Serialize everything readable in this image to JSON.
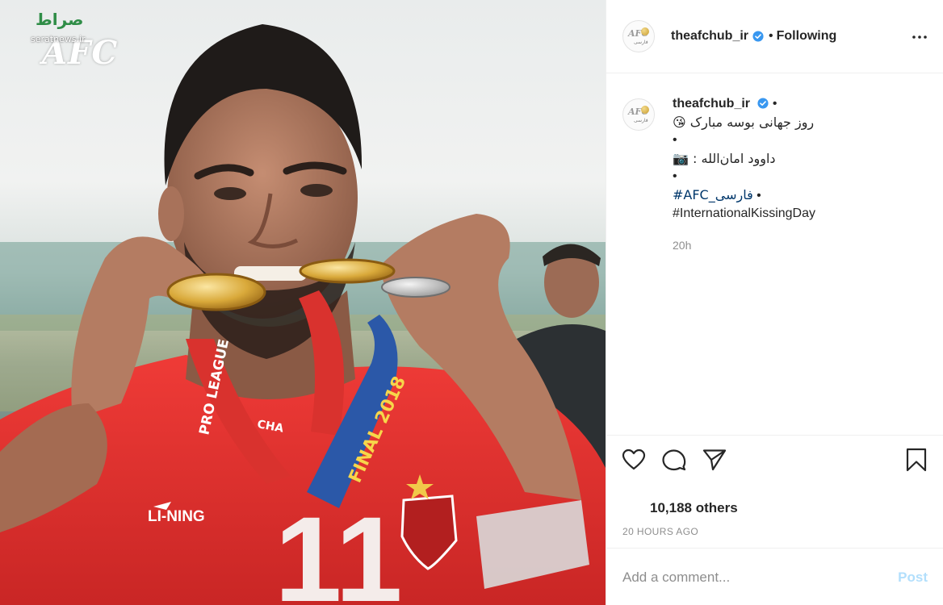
{
  "photo": {
    "watermark": {
      "site": "seratnews.ir",
      "persian_logo": "صراط",
      "brand": "AFC"
    },
    "shirt": {
      "brand": "LI-NING",
      "number": "11"
    },
    "lanyard": {
      "text_pro_league": "PRO LEAGUE",
      "text_final": "FINAL 2018",
      "text_champ": "CHA"
    }
  },
  "header": {
    "username": "theafchub_ir",
    "separator": "•",
    "follow_state": "Following",
    "verified_color": "#3897f0",
    "more_icon": "more-horizontal-icon"
  },
  "caption": {
    "username": "theafchub_ir",
    "after_username": "•",
    "lines": [
      "😘 روز جهانی بوسه مبارک",
      "•",
      "📷 : داوود امان‌الله",
      "•"
    ],
    "hashtag_line_1": "#AFC_فارسی",
    "hashtag_line_1_suffix": " •",
    "hashtag_line_2": "#InternationalKissingDay",
    "time": "20h"
  },
  "actions": {
    "like_icon": "heart-icon",
    "comment_icon": "comment-icon",
    "share_icon": "send-icon",
    "save_icon": "bookmark-icon",
    "likes_text": "10,188 others",
    "time_ago": "20 HOURS AGO"
  },
  "comment": {
    "placeholder": "Add a comment...",
    "post_label": "Post"
  },
  "colors": {
    "jersey_red": "#e8322f",
    "lanyard_blue": "#2b58a8",
    "medal_gold": "#d9a93a",
    "link_blue": "#00376b",
    "post_disabled": "#b2dffc"
  }
}
